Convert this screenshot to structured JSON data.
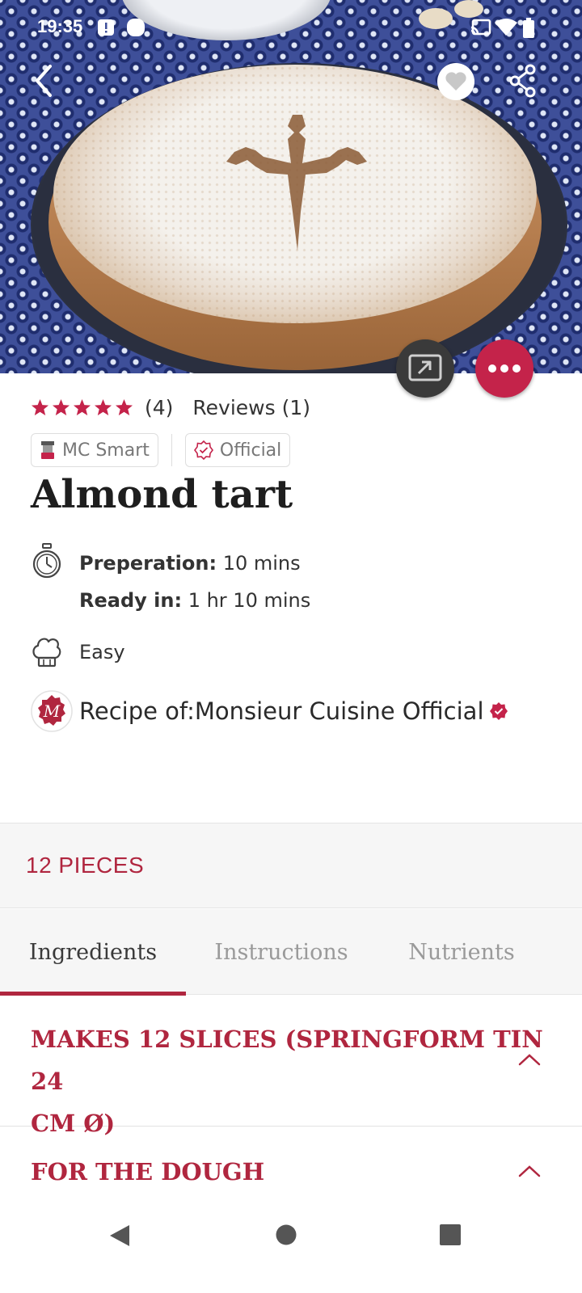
{
  "status_bar": {
    "time": "19:35"
  },
  "recipe": {
    "rating_count": "(4)",
    "reviews_label": "Reviews (1)",
    "chips": [
      {
        "label": "MC Smart"
      },
      {
        "label": "Official"
      }
    ],
    "title": "Almond tart",
    "preparation_label": "Preperation:",
    "preparation_value": "10 mins",
    "ready_label": "Ready in:",
    "ready_value": "1 hr 10 mins",
    "difficulty": "Easy",
    "author_text": "Recipe of:Monsieur Cuisine Official",
    "servings": "12  PIECES"
  },
  "tabs": [
    {
      "label": "Ingredients",
      "active": true
    },
    {
      "label": "Instructions",
      "active": false
    },
    {
      "label": "Nutrients",
      "active": false
    }
  ],
  "sections": [
    {
      "title_line1": "MAKES 12 SLICES (SPRINGFORM TIN 24",
      "title_line2": "CM Ø)"
    },
    {
      "title_line1": "FOR THE DOUGH"
    }
  ],
  "colors": {
    "accent": "#b0263f",
    "fab_more": "#c4234a",
    "fab_cast": "#3a3a3a"
  },
  "icons": [
    "back-arrow-icon",
    "heart-icon",
    "share-icon",
    "cast-icon",
    "more-dots-icon",
    "star-icon",
    "stopwatch-icon",
    "chef-hat-icon",
    "verified-badge-icon",
    "chevron-up-icon"
  ]
}
